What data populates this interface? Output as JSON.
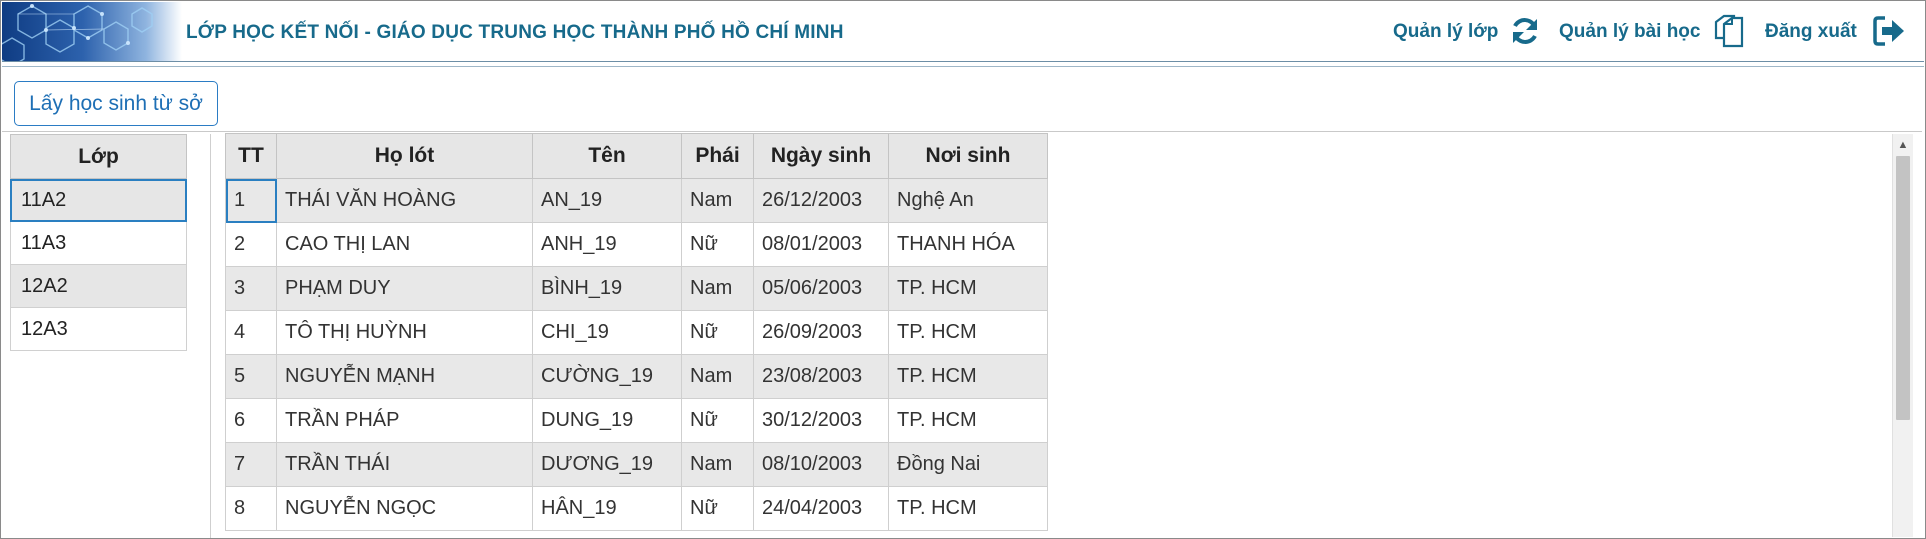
{
  "header": {
    "title": "LỚP HỌC KẾT NỐI -  GIÁO DỤC TRUNG HỌC THÀNH PHỐ HỒ CHÍ MINH",
    "nav": [
      {
        "label": "Quản lý lớp",
        "icon": "refresh-icon"
      },
      {
        "label": "Quản lý bài học",
        "icon": "copy-icon"
      },
      {
        "label": "Đăng xuất",
        "icon": "sign-out-icon"
      }
    ]
  },
  "toolbar": {
    "fetch_label": "Lấy học sinh từ sở"
  },
  "classes": {
    "header": "Lớp",
    "items": [
      "11A2",
      "11A3",
      "12A2",
      "12A3"
    ],
    "selected": "11A2"
  },
  "students": {
    "columns": [
      "TT",
      "Họ lót",
      "Tên",
      "Phái",
      "Ngày sinh",
      "Nơi sinh"
    ],
    "rows": [
      [
        "1",
        "THÁI VĂN HOÀNG",
        "AN_19",
        "Nam",
        "26/12/2003",
        "Nghệ An"
      ],
      [
        "2",
        "CAO THỊ LAN",
        "ANH_19",
        "Nữ",
        "08/01/2003",
        "THANH HÓA"
      ],
      [
        "3",
        "PHẠM DUY",
        "BÌNH_19",
        "Nam",
        "05/06/2003",
        "TP. HCM"
      ],
      [
        "4",
        "TÔ THỊ HUỲNH",
        "CHI_19",
        "Nữ",
        "26/09/2003",
        "TP. HCM"
      ],
      [
        "5",
        "NGUYỄN MẠNH",
        "CƯỜNG_19",
        "Nam",
        "23/08/2003",
        "TP. HCM"
      ],
      [
        "6",
        "TRẦN PHÁP",
        "DUNG_19",
        "Nữ",
        "30/12/2003",
        "TP. HCM"
      ],
      [
        "7",
        "TRẦN THÁI",
        "DƯƠNG_19",
        "Nam",
        "08/10/2003",
        "Đồng Nai"
      ],
      [
        "8",
        "NGUYỄN NGỌC",
        "HÂN_19",
        "Nữ",
        "24/04/2003",
        "TP. HCM"
      ]
    ]
  },
  "colors": {
    "accent": "#176a8b",
    "button_border": "#2b7cc4",
    "selection_outline": "#2a7fc1",
    "header_fill": "#e6e6e6"
  }
}
